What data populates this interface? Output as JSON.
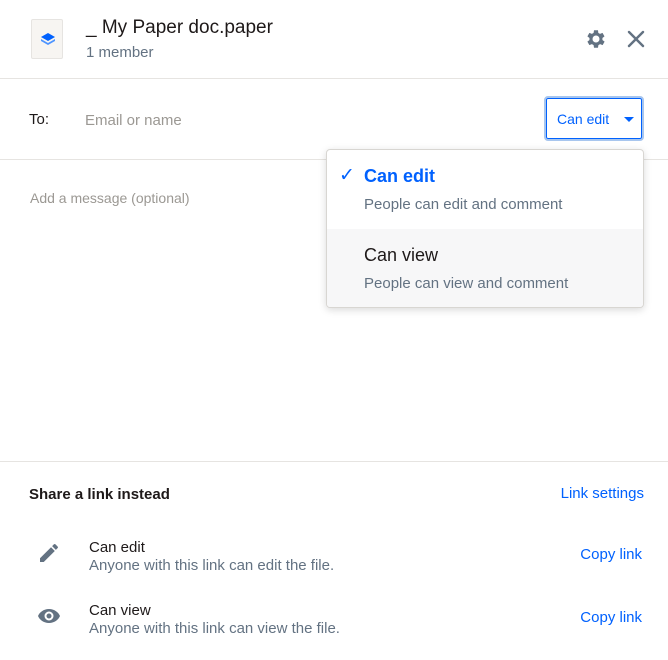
{
  "header": {
    "title": "_ My Paper doc.paper",
    "subtitle": "1 member",
    "settings_icon": "gear-icon",
    "close_icon": "close-icon",
    "file_icon": "paper-doc-icon"
  },
  "to_row": {
    "label": "To:",
    "placeholder": "Email or name",
    "value": "",
    "permission": "Can edit"
  },
  "message": {
    "placeholder": "Add a message (optional)",
    "value": ""
  },
  "dropdown": {
    "items": [
      {
        "title": "Can edit",
        "description": "People can edit and comment",
        "selected": true
      },
      {
        "title": "Can view",
        "description": "People can view and comment",
        "selected": false
      }
    ],
    "check": "✓"
  },
  "share_link": {
    "title": "Share a link instead",
    "settings_label": "Link settings",
    "rows": [
      {
        "icon": "pencil-icon",
        "title": "Can edit",
        "description": "Anyone with this link can edit the file.",
        "action": "Copy link"
      },
      {
        "icon": "eye-icon",
        "title": "Can view",
        "description": "Anyone with this link can view the file.",
        "action": "Copy link"
      }
    ]
  },
  "colors": {
    "accent": "#0061fe",
    "text": "#1e1919",
    "muted": "#637282",
    "divider": "#e6e4e1"
  }
}
